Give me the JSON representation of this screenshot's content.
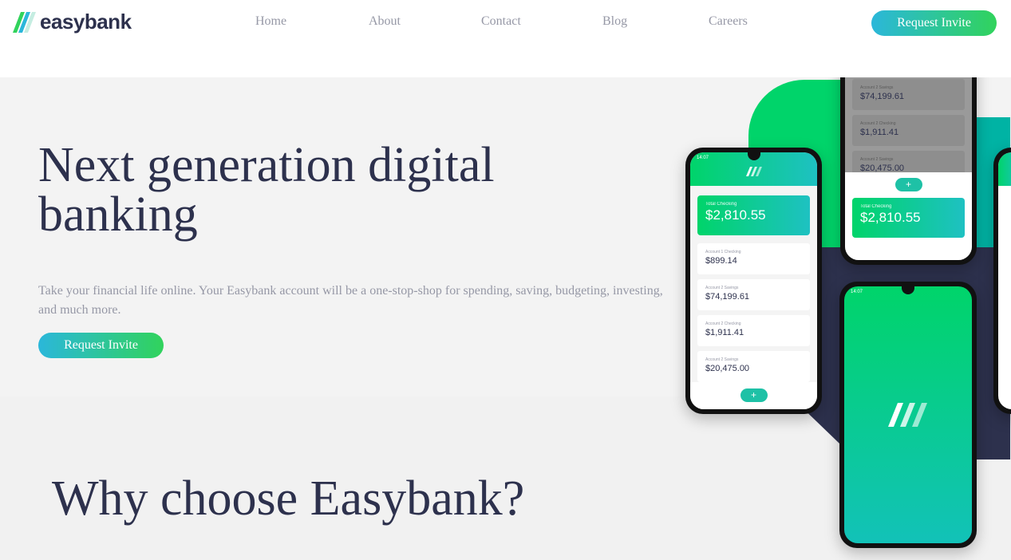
{
  "brand": {
    "name": "easybank"
  },
  "nav": {
    "items": [
      {
        "label": "Home"
      },
      {
        "label": "About"
      },
      {
        "label": "Contact"
      },
      {
        "label": "Blog"
      },
      {
        "label": "Careers"
      }
    ],
    "cta_label": "Request Invite"
  },
  "hero": {
    "title": "Next generation digital banking",
    "description": "Take your financial life online. Your Easybank account will be a one-stop-shop for spending, saving, budgeting, investing, and much more.",
    "cta_label": "Request Invite"
  },
  "why": {
    "title": "Why choose Easybank?"
  },
  "mockup": {
    "time": "14:07",
    "total_label": "Total Checking",
    "total_amount": "$2,810.55",
    "accounts": [
      {
        "label": "Account 1 Checking",
        "amount": "$899.14"
      },
      {
        "label": "Account 2 Savings",
        "amount": "$74,199.61"
      },
      {
        "label": "Account 2 Checking",
        "amount": "$1,911.41"
      },
      {
        "label": "Account 2 Savings",
        "amount": "$20,475.00"
      }
    ]
  },
  "colors": {
    "dark_blue": "#2d314d",
    "lime_green": "#31d35c",
    "bright_cyan": "#2bb7da",
    "grayish_blue": "#9698a6"
  }
}
